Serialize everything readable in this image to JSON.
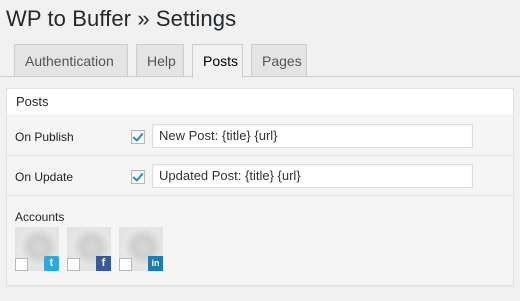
{
  "page": {
    "title": "WP to Buffer » Settings"
  },
  "tabs": [
    {
      "label": "Authentication",
      "active": false
    },
    {
      "label": "Help",
      "active": false
    },
    {
      "label": "Posts",
      "active": true
    },
    {
      "label": "Pages",
      "active": false
    }
  ],
  "panel": {
    "heading": "Posts",
    "rows": [
      {
        "label": "On Publish",
        "checked": true,
        "value": "New Post: {title} {url}"
      },
      {
        "label": "On Update",
        "checked": true,
        "value": "Updated Post: {title} {url}"
      }
    ],
    "accounts_label": "Accounts",
    "accounts": [
      {
        "network": "twitter",
        "icon": "twitter-icon",
        "glyph": "t",
        "checked": false
      },
      {
        "network": "facebook",
        "icon": "facebook-icon",
        "glyph": "f",
        "checked": false
      },
      {
        "network": "linkedin",
        "icon": "linkedin-icon",
        "glyph": "in",
        "checked": false
      }
    ]
  },
  "colors": {
    "accent": "#1e8cbe",
    "twitter": "#2ea7e0",
    "facebook": "#3b5998",
    "linkedin": "#1e7bb5"
  }
}
